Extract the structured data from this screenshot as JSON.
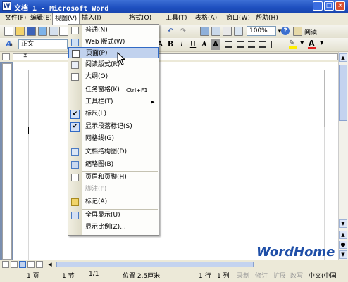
{
  "window": {
    "title": "文档 1 - Microsoft Word",
    "icon_letter": "W",
    "buttons": [
      "_",
      "□",
      "×"
    ]
  },
  "menubar": {
    "items": [
      "文件(F)",
      "编辑(E)",
      "视图(V)",
      "插入(I)",
      "格式(O)",
      "工具(T)",
      "表格(A)",
      "窗口(W)",
      "帮助(H)"
    ],
    "active": "视图(V)"
  },
  "toolbar": {
    "style_value": "正文",
    "style_glyph": "4",
    "zoom_value": "100%",
    "read_label": "阅读",
    "fmt_buttons": [
      "A",
      "B",
      "I",
      "U",
      "A",
      "A"
    ]
  },
  "view_menu": {
    "items": [
      {
        "label": "普通(N)",
        "icon": "normal-view-icon"
      },
      {
        "label": "Web 版式(W)",
        "icon": "web-layout-icon"
      },
      {
        "label": "页面(P)",
        "icon": "page-layout-icon",
        "highlighted": true
      },
      {
        "label": "阅读版式(R)",
        "icon": "reading-layout-icon"
      },
      {
        "label": "大纲(O)",
        "icon": "outline-view-icon"
      },
      {
        "label": "任务窗格(K)",
        "shortcut": "Ctrl+F1"
      },
      {
        "label": "工具栏(T)",
        "submenu": true
      },
      {
        "label": "标尺(L)",
        "checked": true
      },
      {
        "label": "显示段落标记(S)",
        "checked": true
      },
      {
        "label": "网格线(G)"
      },
      {
        "label": "文档结构图(D)",
        "icon": "document-map-icon"
      },
      {
        "label": "缩略图(B)",
        "icon": "thumbnails-icon"
      },
      {
        "label": "页眉和页脚(H)",
        "icon": "header-footer-icon"
      },
      {
        "label": "脚注(F)",
        "disabled": true
      },
      {
        "label": "标记(A)",
        "icon": "markup-icon"
      },
      {
        "label": "全屏显示(U)",
        "icon": "full-screen-icon"
      },
      {
        "label": "显示比例(Z)..."
      }
    ]
  },
  "statusbar": {
    "page": "1 页",
    "section": "1 节",
    "page_of": "1/1",
    "position": "位置 2.5厘米",
    "line": "1 行",
    "column": "1 列",
    "rec": "录制",
    "trk": "修订",
    "ext": "扩展",
    "ovr": "改写",
    "language": "中文(中国"
  },
  "watermark": "WordHome",
  "colors": {
    "titlebar": "#1e4fbf",
    "menu_highlight": "#c1d2ee",
    "font_color_red": "#e02020",
    "highlight_yellow": "#ffee00"
  }
}
